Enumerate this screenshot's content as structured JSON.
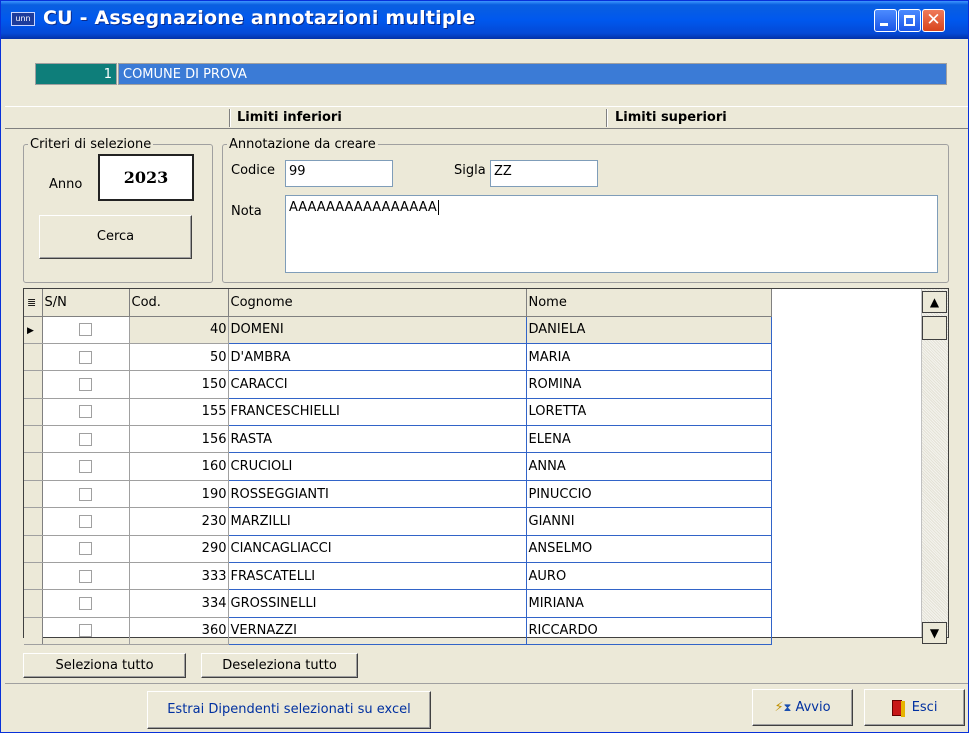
{
  "window": {
    "icon_text": "unn",
    "title": "CU - Assegnazione annotazioni multiple"
  },
  "company": {
    "code": "1",
    "name": "COMUNE DI PROVA"
  },
  "limits": {
    "lower": "Limiti inferiori",
    "upper": "Limiti superiori"
  },
  "criteri": {
    "legend": "Criteri di selezione",
    "anno_label": "Anno",
    "anno_value": "2023",
    "cerca_label": "Cerca"
  },
  "annotazione": {
    "legend": "Annotazione da creare",
    "codice_label": "Codice",
    "codice_value": "99",
    "sigla_label": "Sigla",
    "sigla_value": "ZZ",
    "nota_label": "Nota",
    "nota_value": "AAAAAAAAAAAAAAAA"
  },
  "grid": {
    "headers": {
      "sn": "S/N",
      "cod": "Cod.",
      "cognome": "Cognome",
      "nome": "Nome"
    },
    "rows": [
      {
        "cod": "40",
        "cognome": "DOMENI",
        "nome": "DANIELA"
      },
      {
        "cod": "50",
        "cognome": "D'AMBRA",
        "nome": "MARIA"
      },
      {
        "cod": "150",
        "cognome": "CARACCI",
        "nome": "ROMINA"
      },
      {
        "cod": "155",
        "cognome": "FRANCESCHIELLI",
        "nome": "LORETTA"
      },
      {
        "cod": "156",
        "cognome": "RASTA",
        "nome": "ELENA"
      },
      {
        "cod": "160",
        "cognome": "CRUCIOLI",
        "nome": "ANNA"
      },
      {
        "cod": "190",
        "cognome": "ROSSEGGIANTI",
        "nome": "PINUCCIO"
      },
      {
        "cod": "230",
        "cognome": "MARZILLI",
        "nome": "GIANNI"
      },
      {
        "cod": "290",
        "cognome": "CIANCAGLIACCI",
        "nome": "ANSELMO"
      },
      {
        "cod": "333",
        "cognome": "FRASCATELLI",
        "nome": "AURO"
      },
      {
        "cod": "334",
        "cognome": "GROSSINELLI",
        "nome": "MIRIANA"
      },
      {
        "cod": "360",
        "cognome": "VERNAZZI",
        "nome": "RICCARDO"
      }
    ]
  },
  "actions": {
    "select_all": "Seleziona tutto",
    "deselect_all": "Deseleziona tutto",
    "export": "Estrai Dipendenti selezionati su excel",
    "avvio": "Avvio",
    "esci": "Esci"
  }
}
